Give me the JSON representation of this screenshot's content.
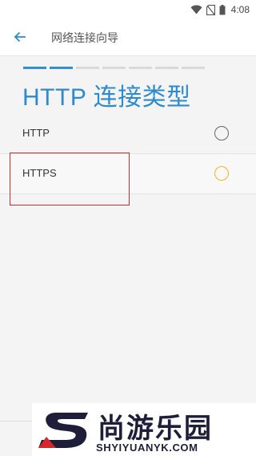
{
  "status_bar": {
    "time": "4:08",
    "icons": [
      "wifi-icon",
      "no-sim-icon",
      "battery-icon"
    ]
  },
  "app_bar": {
    "back_icon": "arrow-left-icon",
    "title": "网络连接向导"
  },
  "progress": {
    "total_steps": 7,
    "current_step": 2,
    "active_color": "#2f8fd8",
    "inactive_color": "#d9d9d9"
  },
  "heading": "HTTP 连接类型",
  "options": [
    {
      "label": "HTTP",
      "selected": false
    },
    {
      "label": "HTTPS",
      "selected": false,
      "highlighted": true
    }
  ],
  "colors": {
    "accent": "#2d8ad0",
    "radio_highlight": "#f2b71c",
    "annotation": "#c9302c"
  },
  "watermark": {
    "name": "尚游乐园",
    "url": "SHYIYUANYK.COM"
  }
}
